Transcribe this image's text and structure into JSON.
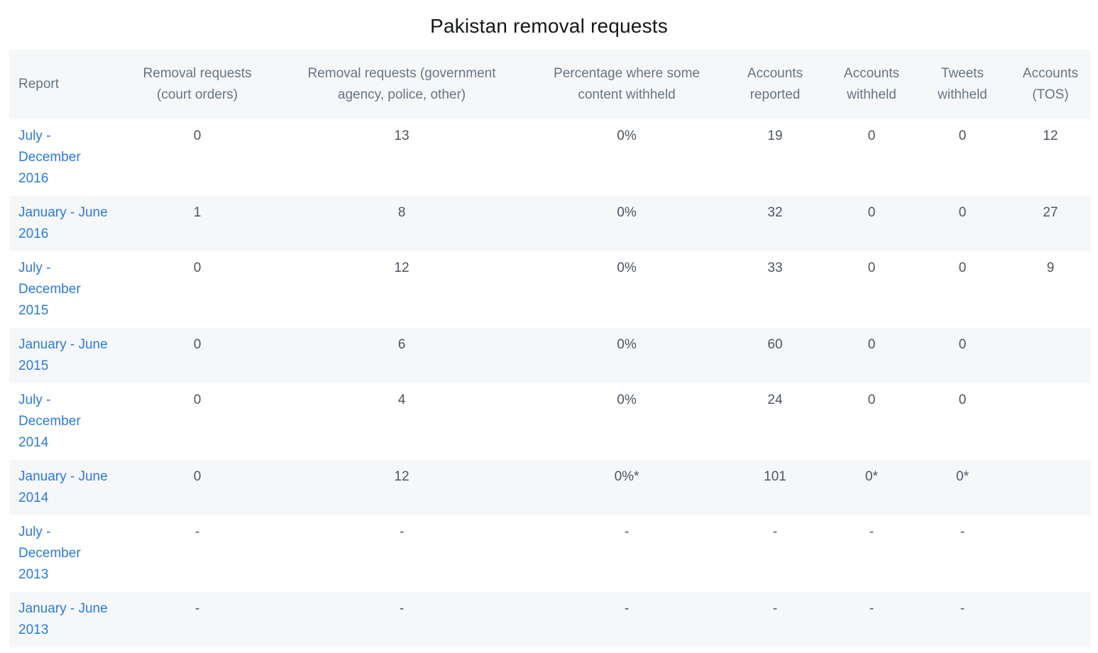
{
  "page": {
    "title": "Pakistan removal requests"
  },
  "table": {
    "headers": [
      "Report",
      "Removal requests (court orders)",
      "Removal requests (government agency, police, other)",
      "Percentage where some content withheld",
      "Accounts reported",
      "Accounts withheld",
      "Tweets withheld",
      "Accounts (TOS)"
    ],
    "header_lines": [
      [
        "Report",
        ""
      ],
      [
        "Removal requests",
        "(court orders)"
      ],
      [
        "Removal requests (government",
        "agency, police, other)"
      ],
      [
        "Percentage where some",
        "content withheld"
      ],
      [
        "Accounts",
        "reported"
      ],
      [
        "Accounts",
        "withheld"
      ],
      [
        "Tweets",
        "withheld"
      ],
      [
        "Accounts",
        "(TOS)"
      ]
    ],
    "rows": [
      {
        "report": [
          "July -",
          "December",
          "2016"
        ],
        "court_orders": "0",
        "gov_requests": "13",
        "pct_withheld": "0%",
        "accounts_reported": "19",
        "accounts_withheld": "0",
        "tweets_withheld": "0",
        "accounts_tos": "12"
      },
      {
        "report": [
          "January - June",
          "2016"
        ],
        "court_orders": "1",
        "gov_requests": "8",
        "pct_withheld": "0%",
        "accounts_reported": "32",
        "accounts_withheld": "0",
        "tweets_withheld": "0",
        "accounts_tos": "27"
      },
      {
        "report": [
          "July -",
          "December",
          "2015"
        ],
        "court_orders": "0",
        "gov_requests": "12",
        "pct_withheld": "0%",
        "accounts_reported": "33",
        "accounts_withheld": "0",
        "tweets_withheld": "0",
        "accounts_tos": "9"
      },
      {
        "report": [
          "January - June",
          "2015"
        ],
        "court_orders": "0",
        "gov_requests": "6",
        "pct_withheld": "0%",
        "accounts_reported": "60",
        "accounts_withheld": "0",
        "tweets_withheld": "0",
        "accounts_tos": ""
      },
      {
        "report": [
          "July -",
          "December",
          "2014"
        ],
        "court_orders": "0",
        "gov_requests": "4",
        "pct_withheld": "0%",
        "accounts_reported": "24",
        "accounts_withheld": "0",
        "tweets_withheld": "0",
        "accounts_tos": ""
      },
      {
        "report": [
          "January - June",
          "2014"
        ],
        "court_orders": "0",
        "gov_requests": "12",
        "pct_withheld": "0%*",
        "accounts_reported": "101",
        "accounts_withheld": "0*",
        "tweets_withheld": "0*",
        "accounts_tos": ""
      },
      {
        "report": [
          "July -",
          "December",
          "2013"
        ],
        "court_orders": "-",
        "gov_requests": "-",
        "pct_withheld": "-",
        "accounts_reported": "-",
        "accounts_withheld": "-",
        "tweets_withheld": "-",
        "accounts_tos": ""
      },
      {
        "report": [
          "January - June",
          "2013"
        ],
        "court_orders": "-",
        "gov_requests": "-",
        "pct_withheld": "-",
        "accounts_reported": "-",
        "accounts_withheld": "-",
        "tweets_withheld": "-",
        "accounts_tos": ""
      }
    ]
  },
  "colors": {
    "link": "#2b7bd8",
    "header_bg": "#f5f7f9",
    "text": "#4d5560"
  }
}
